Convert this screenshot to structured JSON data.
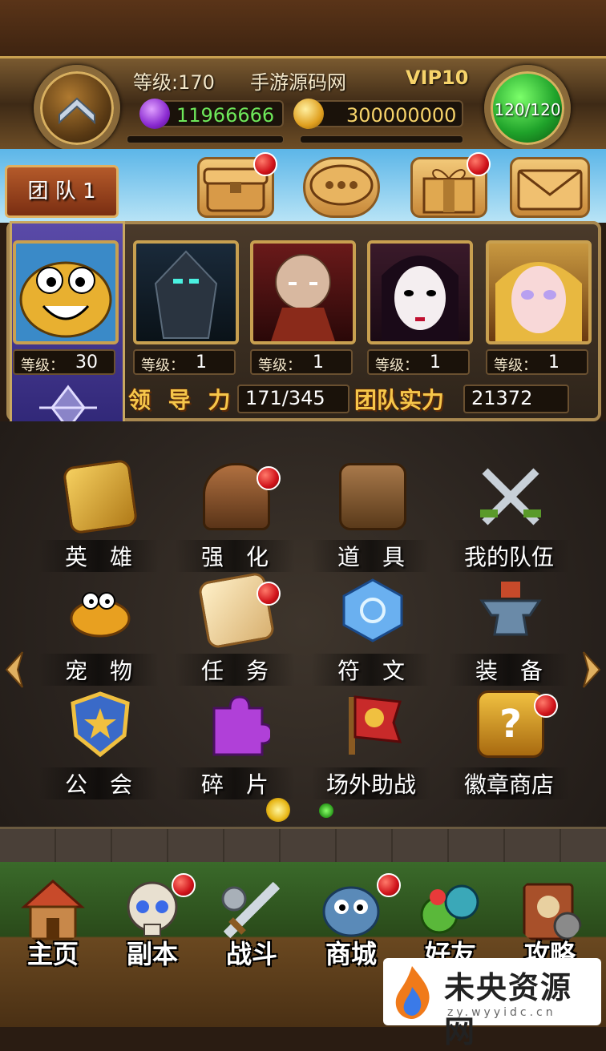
{
  "header": {
    "level": "等级:170",
    "server_name": "手游源码网",
    "vip": "VIP10",
    "crystals": "11966666",
    "gold": "300000000",
    "stamina": "120/120"
  },
  "tabs": {
    "team": "团 队 1"
  },
  "team": {
    "heroes": [
      {
        "level_label": "等级：",
        "level": "30"
      },
      {
        "level_label": "等级：",
        "level": "1"
      },
      {
        "level_label": "等级：",
        "level": "1"
      },
      {
        "level_label": "等级：",
        "level": "1"
      },
      {
        "level_label": "等级：",
        "level": "1"
      }
    ],
    "leadership_label": "领 导 力",
    "leadership": "171/345",
    "power_label": "团队实力",
    "power": "21372"
  },
  "menu": [
    {
      "label": "英　雄",
      "icon": "hero-book-icon"
    },
    {
      "label": "强　化",
      "icon": "upgrade-chest-icon"
    },
    {
      "label": "道　具",
      "icon": "backpack-icon"
    },
    {
      "label": "我的队伍",
      "icon": "crossed-swords-icon"
    },
    {
      "label": "宠　物",
      "icon": "pet-creature-icon"
    },
    {
      "label": "任　务",
      "icon": "quest-scroll-icon"
    },
    {
      "label": "符　文",
      "icon": "rune-gem-icon"
    },
    {
      "label": "装　备",
      "icon": "anvil-icon"
    },
    {
      "label": "公　会",
      "icon": "guild-shield-icon"
    },
    {
      "label": "碎　片",
      "icon": "puzzle-piece-icon"
    },
    {
      "label": "场外助战",
      "icon": "fist-banner-icon"
    },
    {
      "label": "徽章商店",
      "icon": "mystery-chest-icon"
    }
  ],
  "bottom_nav": [
    {
      "label": "主页",
      "icon": "home-house-icon"
    },
    {
      "label": "副本",
      "icon": "skull-dungeon-icon"
    },
    {
      "label": "战斗",
      "icon": "battle-sword-icon"
    },
    {
      "label": "商城",
      "icon": "shop-creature-icon"
    },
    {
      "label": "好友",
      "icon": "friends-icon"
    },
    {
      "label": "攻略",
      "icon": "guide-book-icon"
    }
  ],
  "watermark": {
    "title": "未央资源网",
    "url": "zy.wyyidc.cn"
  },
  "colors": {
    "badge_red": "#d0121a",
    "gold_text": "#f6c64a",
    "crystal_text": "#6ee85a",
    "gold_value_text": "#f6d36a"
  }
}
